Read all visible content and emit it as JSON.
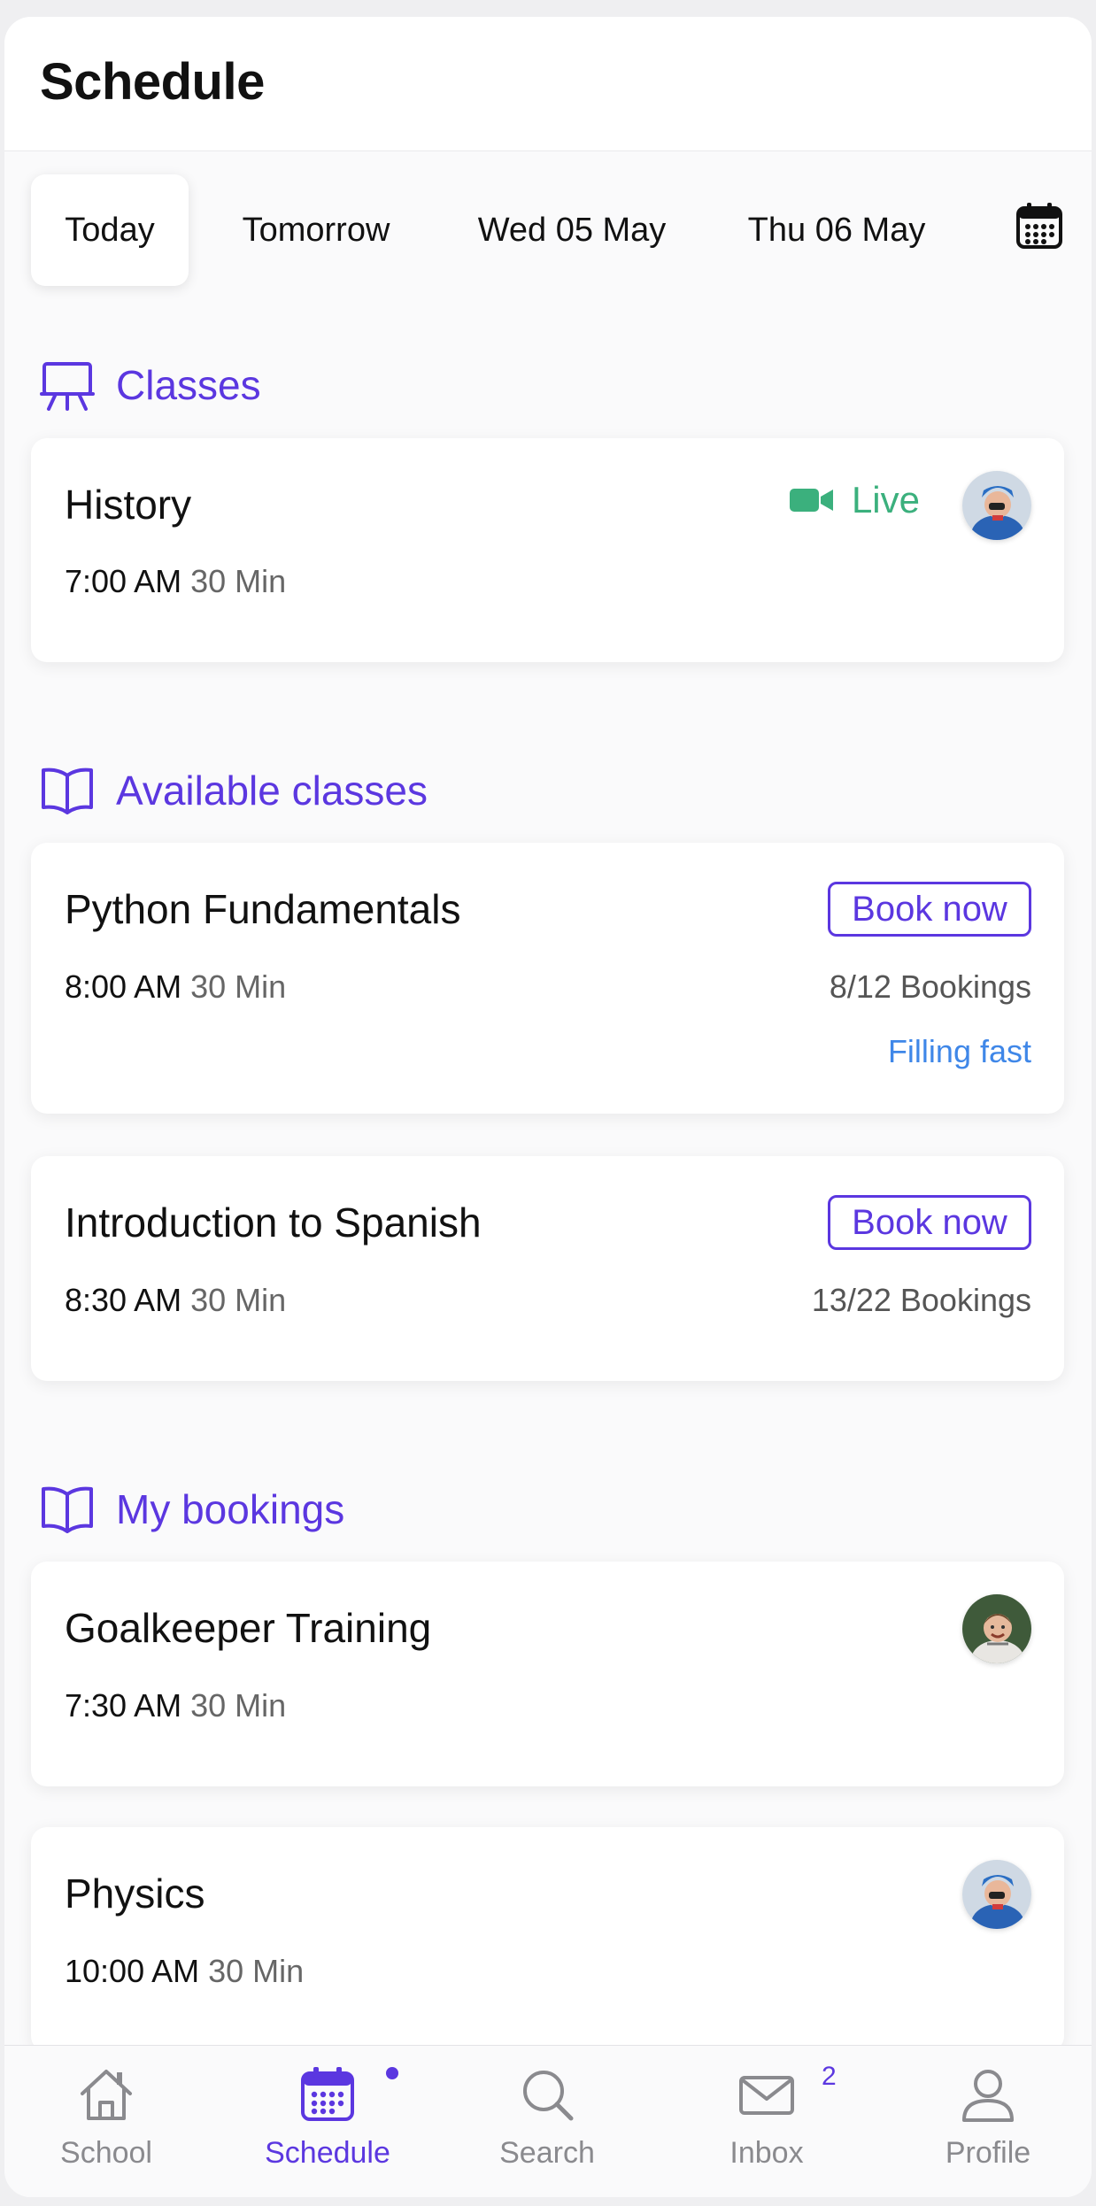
{
  "header": {
    "title": "Schedule"
  },
  "date_tabs": [
    {
      "label": "Today",
      "active": true
    },
    {
      "label": "Tomorrow",
      "active": false
    },
    {
      "label": "Wed 05 May",
      "active": false
    },
    {
      "label": "Thu 06 May",
      "active": false
    }
  ],
  "sections": {
    "classes": {
      "label": "Classes",
      "items": [
        {
          "title": "History",
          "time": "7:00 AM",
          "duration": "30 Min",
          "status": "Live"
        }
      ]
    },
    "available": {
      "label": "Available classes",
      "items": [
        {
          "title": "Python Fundamentals",
          "time": "8:00 AM",
          "duration": "30 Min",
          "action": "Book now",
          "bookings": "8/12 Bookings",
          "note": "Filling fast"
        },
        {
          "title": "Introduction to Spanish",
          "time": "8:30 AM",
          "duration": "30 Min",
          "action": "Book now",
          "bookings": "13/22 Bookings"
        }
      ]
    },
    "bookings": {
      "label": "My bookings",
      "items": [
        {
          "title": "Goalkeeper Training",
          "time": "7:30 AM",
          "duration": "30 Min"
        },
        {
          "title": "Physics",
          "time": "10:00 AM",
          "duration": "30 Min"
        }
      ]
    }
  },
  "nav": [
    {
      "label": "School",
      "icon": "home-icon",
      "active": false
    },
    {
      "label": "Schedule",
      "icon": "calendar-icon",
      "active": true,
      "dot": true
    },
    {
      "label": "Search",
      "icon": "search-icon",
      "active": false
    },
    {
      "label": "Inbox",
      "icon": "mail-icon",
      "active": false,
      "badge": "2"
    },
    {
      "label": "Profile",
      "icon": "user-icon",
      "active": false
    }
  ],
  "colors": {
    "accent": "#5b37e0",
    "live": "#3bb07d",
    "filling": "#3f87e8",
    "muted": "#8a8a8e"
  }
}
